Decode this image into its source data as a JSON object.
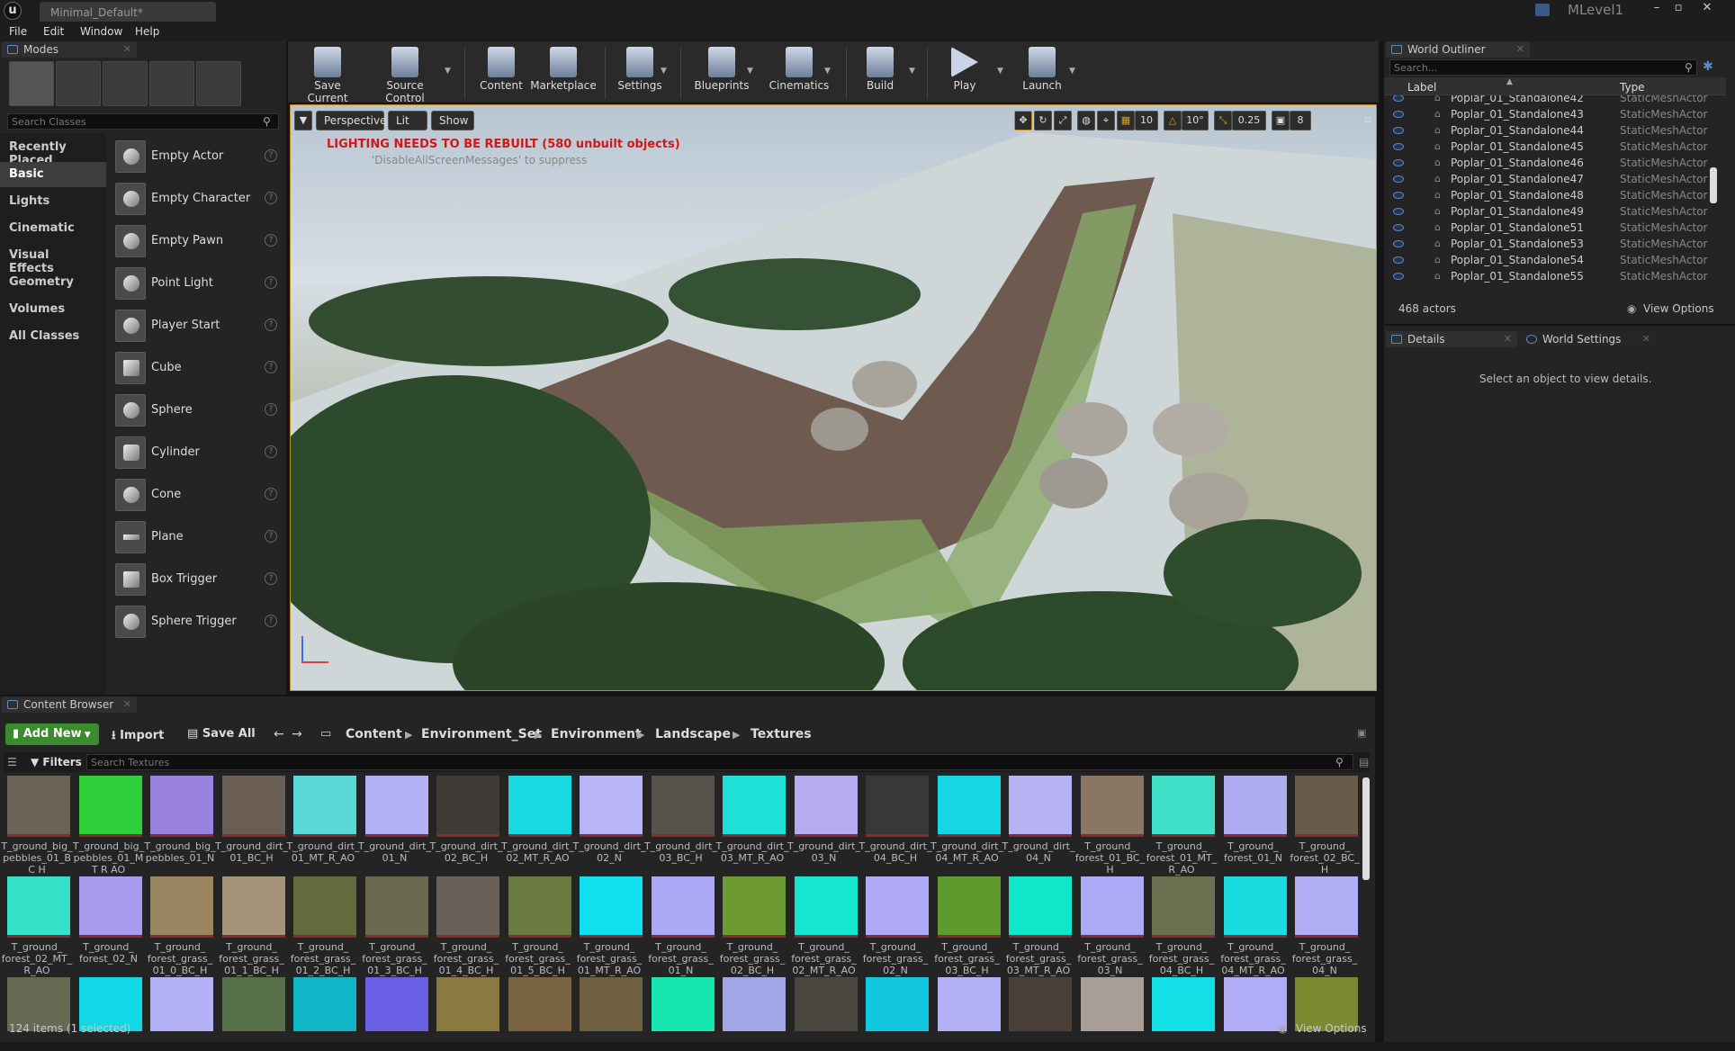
{
  "window": {
    "tab_title": "Minimal_Default*",
    "level_name": "MLevel1"
  },
  "menu": [
    "File",
    "Edit",
    "Window",
    "Help"
  ],
  "modes": {
    "tab_label": "Modes",
    "search_placeholder": "Search Classes",
    "categories": [
      "Recently Placed",
      "Basic",
      "Lights",
      "Cinematic",
      "Visual Effects",
      "Geometry",
      "Volumes",
      "All Classes"
    ],
    "active_category": "Basic",
    "items": [
      "Empty Actor",
      "Empty Character",
      "Empty Pawn",
      "Point Light",
      "Player Start",
      "Cube",
      "Sphere",
      "Cylinder",
      "Cone",
      "Plane",
      "Box Trigger",
      "Sphere Trigger"
    ]
  },
  "toolbar": {
    "buttons": [
      "Save Current",
      "Source Control",
      "Content",
      "Marketplace",
      "Settings",
      "Blueprints",
      "Cinematics",
      "Build",
      "Play",
      "Launch"
    ]
  },
  "viewport": {
    "perspective": "Perspective",
    "lit": "Lit",
    "show": "Show",
    "grid_snap": "10",
    "rot_snap": "10°",
    "scale_snap": "0.25",
    "cam_speed": "8",
    "warning": "LIGHTING NEEDS TO BE REBUILT (580 unbuilt objects)",
    "suppress_hint": "'DisableAllScreenMessages' to suppress"
  },
  "outliner": {
    "tab_label": "World Outliner",
    "search_placeholder": "Search...",
    "col_label": "Label",
    "col_type": "Type",
    "rows": [
      {
        "label": "Poplar_01_Standalone42",
        "type": "StaticMeshActor"
      },
      {
        "label": "Poplar_01_Standalone43",
        "type": "StaticMeshActor"
      },
      {
        "label": "Poplar_01_Standalone44",
        "type": "StaticMeshActor"
      },
      {
        "label": "Poplar_01_Standalone45",
        "type": "StaticMeshActor"
      },
      {
        "label": "Poplar_01_Standalone46",
        "type": "StaticMeshActor"
      },
      {
        "label": "Poplar_01_Standalone47",
        "type": "StaticMeshActor"
      },
      {
        "label": "Poplar_01_Standalone48",
        "type": "StaticMeshActor"
      },
      {
        "label": "Poplar_01_Standalone49",
        "type": "StaticMeshActor"
      },
      {
        "label": "Poplar_01_Standalone51",
        "type": "StaticMeshActor"
      },
      {
        "label": "Poplar_01_Standalone53",
        "type": "StaticMeshActor"
      },
      {
        "label": "Poplar_01_Standalone54",
        "type": "StaticMeshActor"
      },
      {
        "label": "Poplar_01_Standalone55",
        "type": "StaticMeshActor"
      }
    ],
    "actor_count": "468 actors",
    "view_options": "View Options"
  },
  "details": {
    "tab_details": "Details",
    "tab_world": "World Settings",
    "empty_text": "Select an object to view details."
  },
  "content_browser": {
    "tab_label": "Content Browser",
    "add_new": "Add New",
    "import": "Import",
    "save_all": "Save All",
    "path": [
      "Content",
      "Environment_Set",
      "Environment",
      "Landscape",
      "Textures"
    ],
    "filters": "Filters",
    "search_placeholder": "Search Textures",
    "status": "124 items (1 selected)",
    "view_options": "View Options",
    "assets": [
      {
        "name": "T_ground_big_ pebbles_01_BC H",
        "color": "#6c6255"
      },
      {
        "name": "T_ground_big_ pebbles_01_MT R AO",
        "color": "#2ed03a"
      },
      {
        "name": "T_ground_big_ pebbles_01_N",
        "color": "#9a82e0"
      },
      {
        "name": "T_ground_dirt_ 01_BC_H",
        "color": "#6b5e54"
      },
      {
        "name": "T_ground_dirt_ 01_MT_R_AO",
        "color": "#5ad8d8"
      },
      {
        "name": "T_ground_dirt_ 01_N",
        "color": "#b4b0f6"
      },
      {
        "name": "T_ground_dirt_ 02_BC_H",
        "color": "#3e3a36"
      },
      {
        "name": "T_ground_dirt_ 02_MT_R_AO",
        "color": "#18d8e0"
      },
      {
        "name": "T_ground_dirt_ 02_N",
        "color": "#b8b4f6"
      },
      {
        "name": "T_ground_dirt_ 03_BC_H",
        "color": "#56524c"
      },
      {
        "name": "T_ground_dirt_ 03_MT_R_AO",
        "color": "#1ee0d8"
      },
      {
        "name": "T_ground_dirt_ 03_N",
        "color": "#b4acee"
      },
      {
        "name": "T_ground_dirt_ 04_BC_H",
        "color": "#3a3836"
      },
      {
        "name": "T_ground_dirt_ 04_MT_R_AO",
        "color": "#16d6e6"
      },
      {
        "name": "T_ground_dirt_ 04_N",
        "color": "#b6b2f4"
      },
      {
        "name": "T_ground_ forest_01_BC_H",
        "color": "#8a7664"
      },
      {
        "name": "T_ground_ forest_01_MT_ R_AO",
        "color": "#40e0c8"
      },
      {
        "name": "T_ground_ forest_01_N",
        "color": "#b0acf2"
      },
      {
        "name": "T_ground_ forest_02_BC_H",
        "color": "#6a5a4c"
      },
      {
        "name": "T_ground_ forest_02_MT_ R_AO",
        "color": "#34e0c8"
      },
      {
        "name": "T_ground_ forest_02_N",
        "color": "#a89cf0"
      },
      {
        "name": "T_ground_ forest_grass_ 01_0_BC_H",
        "color": "#9a8560"
      },
      {
        "name": "T_ground_ forest_grass_ 01_1_BC_H",
        "color": "#a4947a"
      },
      {
        "name": "T_ground_ forest_grass_ 01_2_BC_H",
        "color": "#646a3c"
      },
      {
        "name": "T_ground_ forest_grass_ 01_3_BC_H",
        "color": "#6a6a50"
      },
      {
        "name": "T_ground_ forest_grass_ 01_4_BC_H",
        "color": "#6a6058"
      },
      {
        "name": "T_ground_ forest_grass_ 01_5_BC_H",
        "color": "#6a7a40"
      },
      {
        "name": "T_ground_ forest_grass_ 01_MT_R_AO",
        "color": "#0ee0f0"
      },
      {
        "name": "T_ground_ forest_grass_ 01_N",
        "color": "#aca8f6"
      },
      {
        "name": "T_ground_ forest_grass_ 02_BC_H",
        "color": "#6e9a34"
      },
      {
        "name": "T_ground_ forest_grass_ 02_MT_R_AO",
        "color": "#14e6d0"
      },
      {
        "name": "T_ground_ forest_grass_ 02_N",
        "color": "#b0aaf6"
      },
      {
        "name": "T_ground_ forest_grass_ 03_BC_H",
        "color": "#5e9a2e"
      },
      {
        "name": "T_ground_ forest_grass_ 03_MT_R_AO",
        "color": "#10e6c8"
      },
      {
        "name": "T_ground_ forest_grass_ 03_N",
        "color": "#acaaf6"
      },
      {
        "name": "T_ground_ forest_grass_ 04_BC_H",
        "color": "#6a7050"
      },
      {
        "name": "T_ground_ forest_grass_ 04_MT_R_AO",
        "color": "#1adce0"
      },
      {
        "name": "T_ground_ forest_grass_ 04_N",
        "color": "#b2aef6"
      },
      {
        "name": "",
        "color": "#666a52"
      },
      {
        "name": "",
        "color": "#10d8e6"
      },
      {
        "name": "",
        "color": "#b4b0f6"
      },
      {
        "name": "",
        "color": "#56704a"
      },
      {
        "name": "",
        "color": "#10b6c6"
      },
      {
        "name": "",
        "color": "#6a60e6"
      },
      {
        "name": "",
        "color": "#8a7a40"
      },
      {
        "name": "",
        "color": "#7a6444"
      },
      {
        "name": "",
        "color": "#6e6040"
      },
      {
        "name": "",
        "color": "#18e6b0"
      },
      {
        "name": "",
        "color": "#a0a6e6"
      },
      {
        "name": "",
        "color": "#4a4640"
      },
      {
        "name": "",
        "color": "#12c8e0"
      },
      {
        "name": "",
        "color": "#b4b0f6"
      },
      {
        "name": "",
        "color": "#4a4038"
      },
      {
        "name": "",
        "color": "#a89e96"
      },
      {
        "name": "",
        "color": "#12e0e6"
      },
      {
        "name": "",
        "color": "#b0acf6"
      },
      {
        "name": "",
        "color": "#7a8a30"
      }
    ]
  }
}
